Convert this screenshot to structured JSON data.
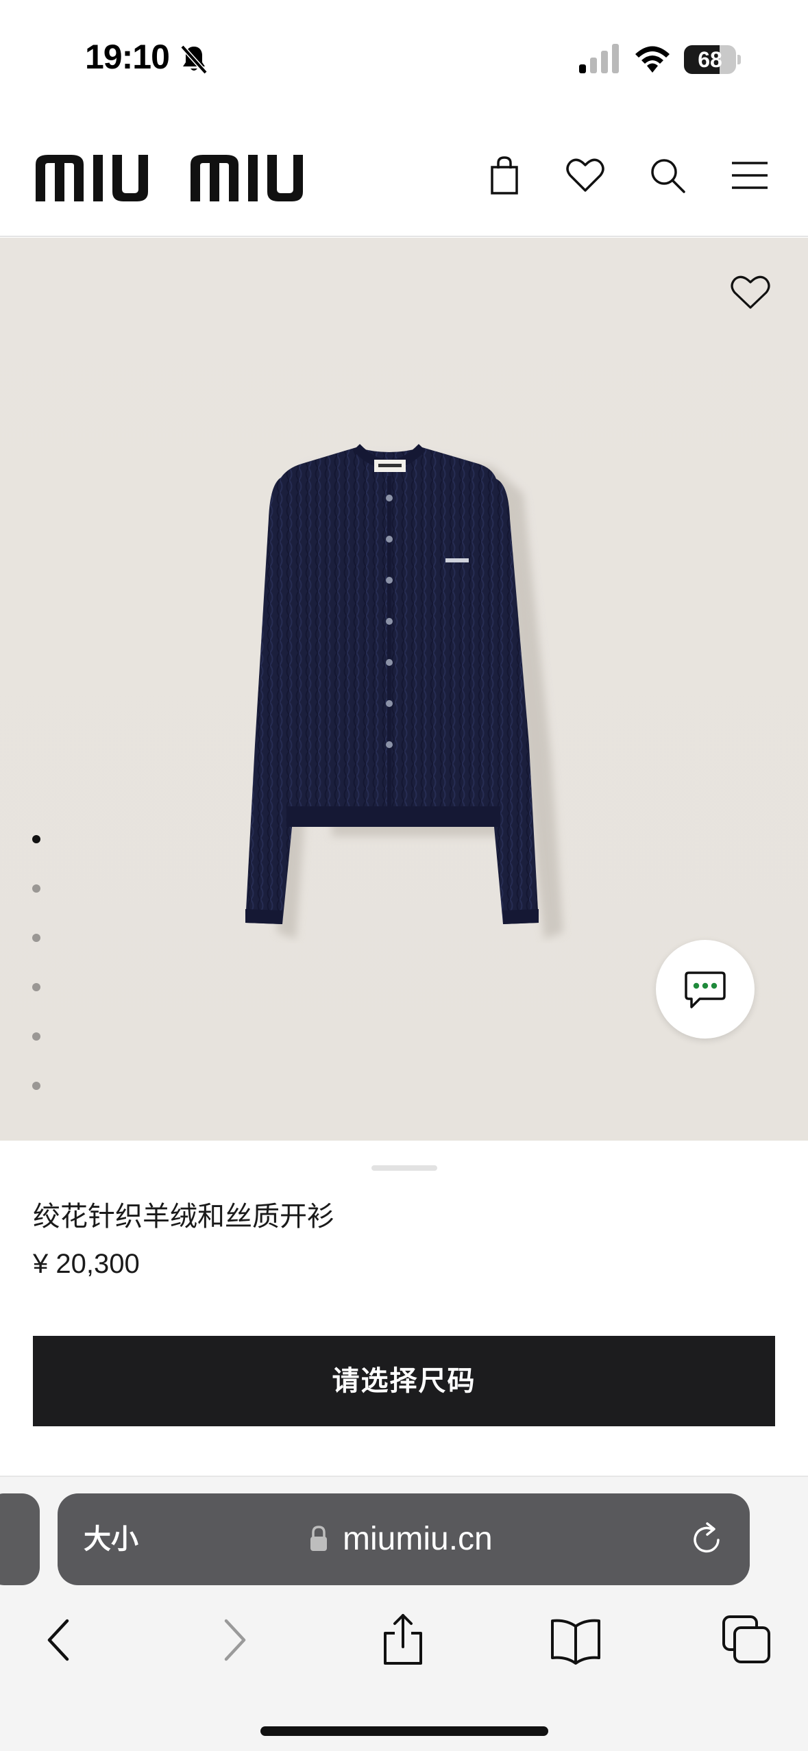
{
  "status_bar": {
    "time": "19:10",
    "battery_level": "68",
    "battery_fraction": 0.68,
    "icons": [
      "bell-muted-icon",
      "cellular-signal-icon",
      "wifi-icon",
      "battery-icon"
    ]
  },
  "header": {
    "logo_text": "miu miu",
    "icons": [
      "shopping-bag-icon",
      "heart-icon",
      "search-icon",
      "menu-icon"
    ]
  },
  "gallery": {
    "image_count": 6,
    "active_index": 0,
    "product_color": "#1b1f3d",
    "background_color": "#e8e4df"
  },
  "product": {
    "name": "绞花针织羊绒和丝质开衫",
    "price": "¥ 20,300",
    "cta_label": "请选择尺码"
  },
  "browser": {
    "text_size_label": "大小",
    "url": "miumiu.cn",
    "toolbar_icons": [
      "back-icon",
      "forward-icon",
      "share-icon",
      "bookmarks-icon",
      "tabs-icon"
    ]
  },
  "colors": {
    "accent_dark": "#1c1c1e",
    "chat_dots": "#1f8a3b"
  }
}
